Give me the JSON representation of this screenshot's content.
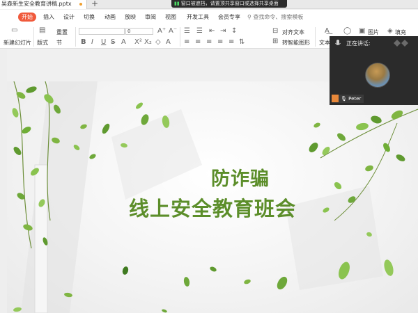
{
  "tabbar": {
    "doc_tab": "吴森新生安全教育讲稿.pptx",
    "add_tab": "+"
  },
  "share_banner": {
    "text": "窗口被遮挡，请置顶共享窗口或选择共享桌面"
  },
  "menu": {
    "items": [
      "开始",
      "插入",
      "设计",
      "切换",
      "动画",
      "放映",
      "审阅",
      "视图",
      "开发工具",
      "会员专享"
    ],
    "active": "开始",
    "search": "查找命令、搜索模板"
  },
  "ribbon": {
    "new_slide": "新建幻灯片",
    "layout": "版式",
    "reset": "重置",
    "section": "节",
    "font_size": "0",
    "align_text": "对齐文本",
    "smart_art": "转智能图形",
    "text_box": "文本",
    "picture": "图片",
    "fill": "填充"
  },
  "slide": {
    "title_line1": "防诈骗",
    "title_line2": "线上安全教育班会"
  },
  "video": {
    "speaking_label": "正在讲话:",
    "participant": "Peter"
  },
  "colors": {
    "accent_tab": "#f05a3c",
    "title_green": "#5c8e2a"
  }
}
